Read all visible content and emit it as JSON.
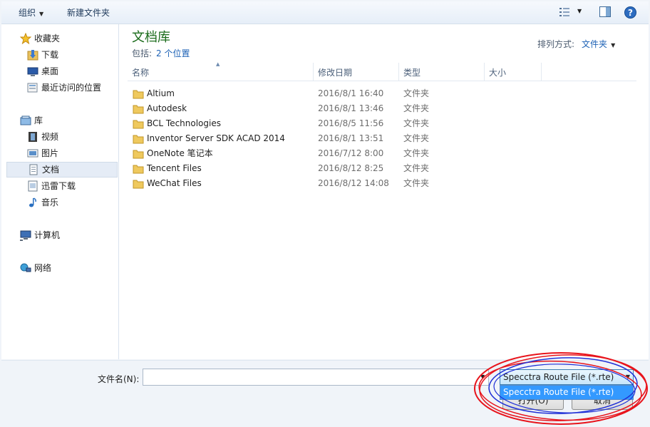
{
  "toolbar": {
    "organize_label": "组织",
    "new_folder_label": "新建文件夹",
    "icons": [
      "views-icon",
      "preview-pane-icon",
      "help-icon"
    ]
  },
  "nav": {
    "favorites": {
      "label": "收藏夹",
      "icon": "star-icon"
    },
    "favorites_items": [
      {
        "label": "下载",
        "icon": "downloads-folder-icon"
      },
      {
        "label": "桌面",
        "icon": "desktop-icon"
      },
      {
        "label": "最近访问的位置",
        "icon": "recent-places-icon"
      }
    ],
    "libraries": {
      "label": "库",
      "icon": "library-icon"
    },
    "library_items": [
      {
        "label": "视频",
        "icon": "video-library-icon"
      },
      {
        "label": "图片",
        "icon": "picture-library-icon"
      },
      {
        "label": "文档",
        "icon": "document-library-icon",
        "selected": true
      },
      {
        "label": "迅雷下载",
        "icon": "thunder-download-icon"
      },
      {
        "label": "音乐",
        "icon": "music-library-icon"
      }
    ],
    "computer": {
      "label": "计算机",
      "icon": "computer-icon"
    },
    "network": {
      "label": "网络",
      "icon": "network-icon"
    }
  },
  "content": {
    "title": "文档库",
    "includes_label": "包括:",
    "includes_link": "2 个位置",
    "arrange_label": "排列方式:",
    "arrange_value": "文件夹",
    "columns": {
      "name": "名称",
      "modified": "修改日期",
      "type": "类型",
      "size": "大小"
    },
    "files": [
      {
        "name": "Altium",
        "modified": "2016/8/1 16:40",
        "type": "文件夹"
      },
      {
        "name": "Autodesk",
        "modified": "2016/8/1 13:46",
        "type": "文件夹"
      },
      {
        "name": "BCL Technologies",
        "modified": "2016/8/5 11:56",
        "type": "文件夹"
      },
      {
        "name": "Inventor Server SDK ACAD 2014",
        "modified": "2016/8/1 13:51",
        "type": "文件夹"
      },
      {
        "name": "OneNote 笔记本",
        "modified": "2016/7/12 8:00",
        "type": "文件夹"
      },
      {
        "name": "Tencent Files",
        "modified": "2016/8/12 8:25",
        "type": "文件夹"
      },
      {
        "name": "WeChat Files",
        "modified": "2016/8/12 14:08",
        "type": "文件夹"
      }
    ]
  },
  "bottom": {
    "filename_label": "文件名(N):",
    "filename_value": "",
    "filetype_selected": "Specctra Route File (*.rte)",
    "filetype_options": [
      "Specctra Route File (*.rte)"
    ],
    "open_label": "打开(O)",
    "cancel_label": "取消"
  },
  "colors": {
    "title_green": "#1a6b1a",
    "link_blue": "#1c61b5",
    "selection_blue": "#3399ff",
    "annotation_red": "#e8141c",
    "annotation_blue": "#1f2fd6"
  }
}
